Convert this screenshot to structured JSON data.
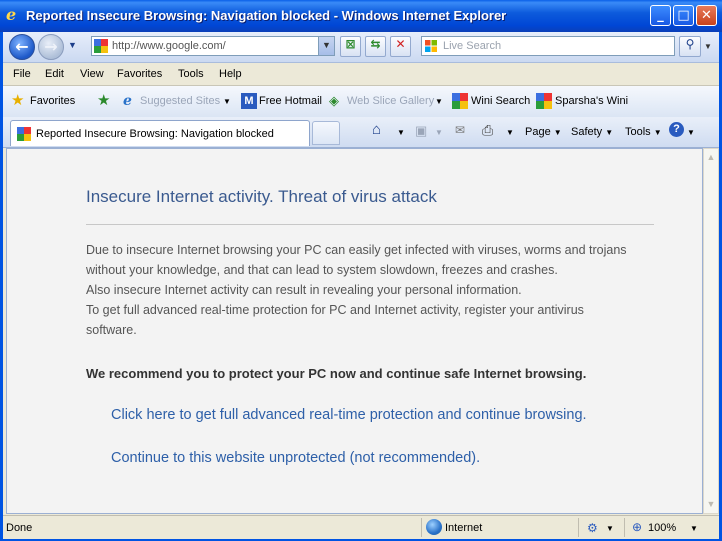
{
  "window": {
    "title": "Reported Insecure Browsing: Navigation blocked - Windows Internet Explorer",
    "minimize": "_",
    "maximize": "□",
    "close": "✕"
  },
  "address": {
    "url": "http://www.google.com/",
    "search_placeholder": "Live Search"
  },
  "menu": [
    "File",
    "Edit",
    "View",
    "Favorites",
    "Tools",
    "Help"
  ],
  "favorites_bar": {
    "favorites": "Favorites",
    "items": [
      "Suggested Sites",
      "Free Hotmail",
      "Web Slice Gallery",
      "Wini Search",
      "Sparsha's Wini"
    ]
  },
  "tab": {
    "title": "Reported Insecure Browsing: Navigation blocked"
  },
  "command_bar": {
    "page": "Page",
    "safety": "Safety",
    "tools": "Tools"
  },
  "page": {
    "heading": "Insecure Internet activity. Threat of virus attack",
    "paragraph_lines": [
      "Due to insecure Internet browsing your PC can easily get infected with viruses, worms and trojans",
      "without your knowledge, and that can lead to system slowdown, freezes and crashes.",
      "Also insecure Internet activity can result in revealing your personal information.",
      "To get full advanced real-time protection for PC and Internet activity, register your antivirus",
      "software."
    ],
    "recommendation": "We recommend you to protect your PC now and continue safe Internet browsing.",
    "link_protect": "Click here to get full advanced real-time protection and continue browsing.",
    "link_continue": "Continue to this website unprotected (not recommended)."
  },
  "status": {
    "text": "Done",
    "zone": "Internet",
    "zoom": "100%"
  }
}
